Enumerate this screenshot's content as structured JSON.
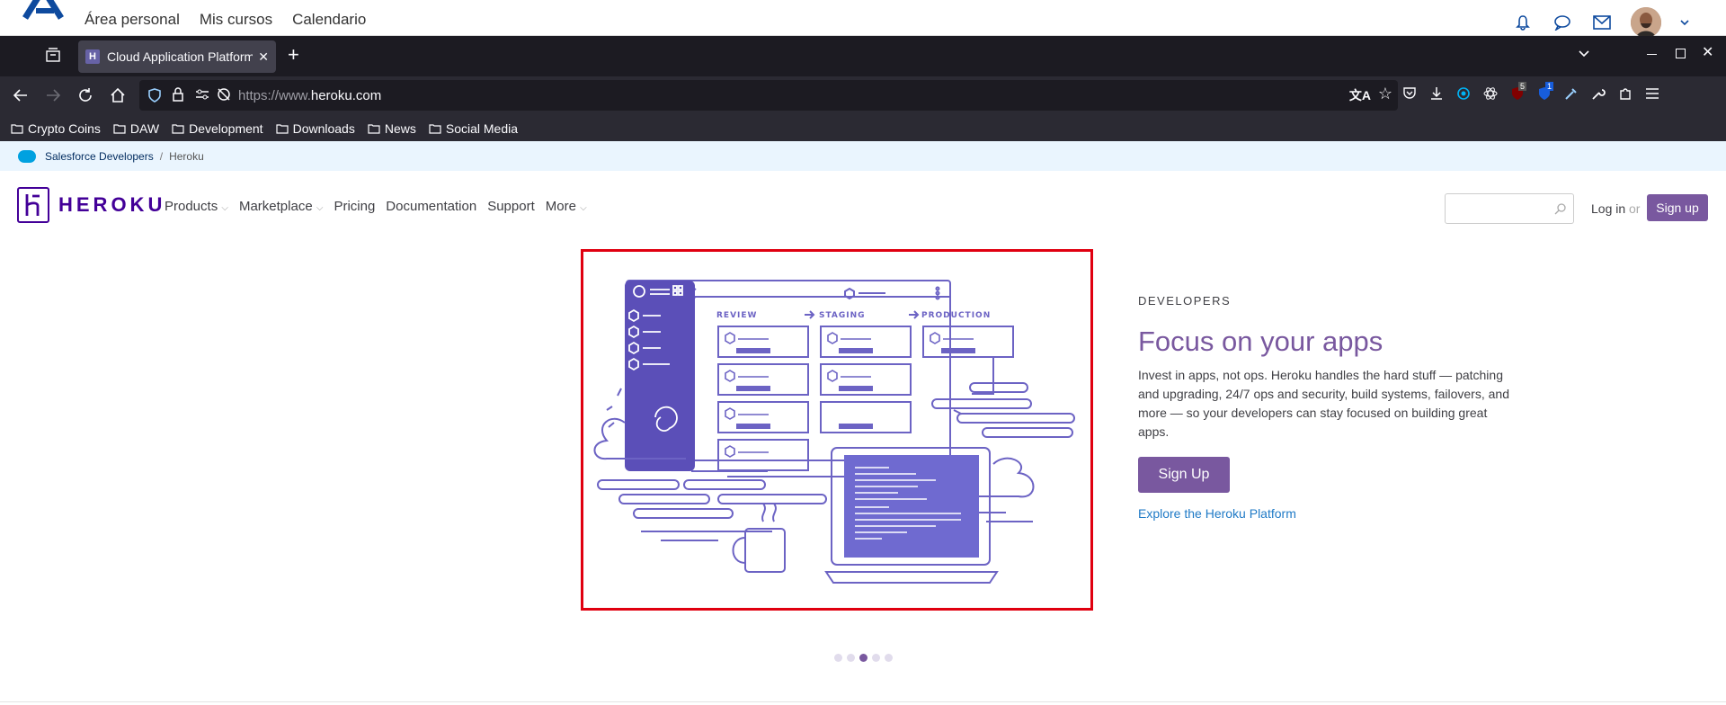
{
  "moodle": {
    "nav": [
      "Área personal",
      "Mis cursos",
      "Calendario"
    ]
  },
  "browser": {
    "tab_title": "Cloud Application Platform",
    "url_gray": "https://www.",
    "url_host": "heroku.com",
    "bookmarks": [
      "Crypto Coins",
      "DAW",
      "Development",
      "Downloads",
      "News",
      "Social Media"
    ],
    "badges": {
      "ublock": "5",
      "ext": "1"
    }
  },
  "breadcrumb": {
    "parent": "Salesforce Developers",
    "sep": "/",
    "current": "Heroku"
  },
  "header": {
    "brand": "HEROKU",
    "menu": [
      {
        "label": "Products",
        "caret": true
      },
      {
        "label": "Marketplace",
        "caret": true
      },
      {
        "label": "Pricing",
        "caret": false
      },
      {
        "label": "Documentation",
        "caret": false
      },
      {
        "label": "Support",
        "caret": false
      },
      {
        "label": "More",
        "caret": true
      }
    ],
    "login": "Log in",
    "or": "or",
    "signup": "Sign up"
  },
  "hero": {
    "illustration": {
      "stages": [
        "REVIEW",
        "STAGING",
        "PRODUCTION"
      ]
    },
    "eyebrow": "DEVELOPERS",
    "title": "Focus on your apps",
    "body": "Invest in apps, not ops. Heroku handles the hard stuff — patching and upgrading, 24/7 ops and security, build systems, failovers, and more — so your developers can stay focused on building great apps.",
    "cta": "Sign Up",
    "link": "Explore the Heroku Platform",
    "carousel_active": 2,
    "carousel_count": 5
  },
  "colors": {
    "heroku_purple": "#79589f",
    "brand": "#430098",
    "highlight": "#e00010"
  }
}
